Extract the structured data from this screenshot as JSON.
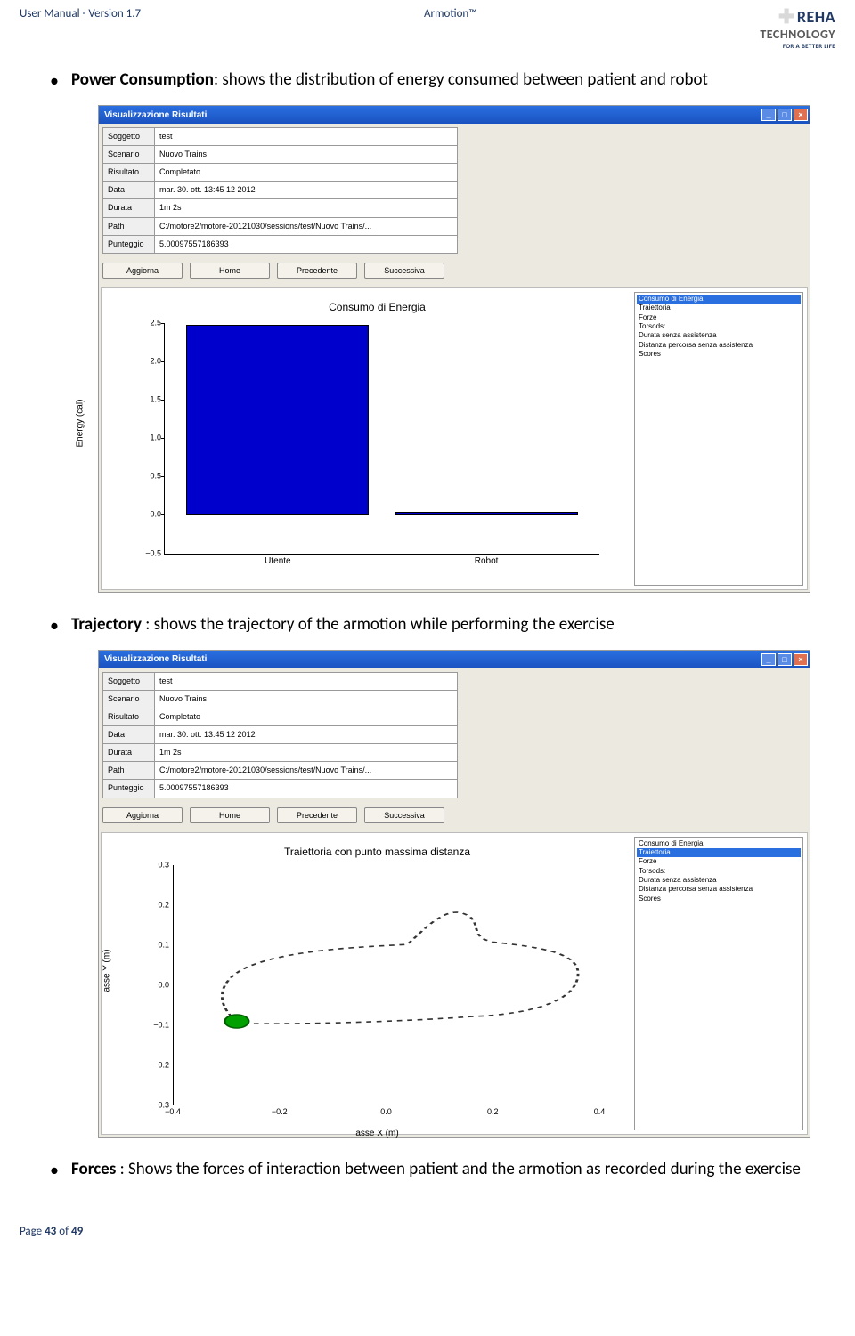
{
  "header": {
    "left": "User Manual - Version 1.7",
    "center": "Armotion™",
    "logo_main": "REHA",
    "logo_sub": "TECHNOLOGY",
    "logo_tag": "FOR A BETTER LIFE"
  },
  "bullets": {
    "power_label": "Power Consumption",
    "power_text": ": shows the distribution of energy consumed between patient and robot",
    "traj_label": "Trajectory",
    "traj_text": " : shows the trajectory of the armotion while performing the exercise",
    "forces_label": "Forces",
    "forces_text": " : Shows the forces of interaction between patient and the armotion as recorded during the exercise"
  },
  "win1": {
    "title": "Visualizzazione Risultati",
    "rows": [
      [
        "Soggetto",
        "test"
      ],
      [
        "Scenario",
        "Nuovo Trains"
      ],
      [
        "Risultato",
        "Completato"
      ],
      [
        "Data",
        "mar. 30. ott. 13:45 12 2012"
      ],
      [
        "Durata",
        "1m 2s"
      ],
      [
        "Path",
        "C:/motore2/motore-20121030/sessions/test/Nuovo Trains/..."
      ],
      [
        "Punteggio",
        "5.00097557186393"
      ]
    ],
    "buttons": [
      "Aggiorna",
      "Home",
      "Precedente",
      "Successiva"
    ],
    "list": [
      "Consumo di Energia",
      "Traiettoria",
      "Forze",
      "Torsods:",
      "Durata senza assistenza",
      "Distanza percorsa senza assistenza",
      "Scores"
    ],
    "selected": 0,
    "chart_title": "Consumo di Energia",
    "ylabel": "Energy (cal)"
  },
  "win2": {
    "title": "Visualizzazione Risultati",
    "rows": [
      [
        "Soggetto",
        "test"
      ],
      [
        "Scenario",
        "Nuovo Trains"
      ],
      [
        "Risultato",
        "Completato"
      ],
      [
        "Data",
        "mar. 30. ott. 13:45 12 2012"
      ],
      [
        "Durata",
        "1m 2s"
      ],
      [
        "Path",
        "C:/motore2/motore-20121030/sessions/test/Nuovo Trains/..."
      ],
      [
        "Punteggio",
        "5.00097557186393"
      ]
    ],
    "buttons": [
      "Aggiorna",
      "Home",
      "Precedente",
      "Successiva"
    ],
    "list": [
      "Consumo di Energia",
      "Traiettoria",
      "Forze",
      "Torsods:",
      "Durata senza assistenza",
      "Distanza percorsa senza assistenza",
      "Scores"
    ],
    "selected": 1,
    "chart_title": "Traiettoria con punto massima distanza",
    "xlabel": "asse X (m)",
    "ylabel": "asse Y (m)"
  },
  "chart_data": [
    {
      "type": "bar",
      "title": "Consumo di Energia",
      "ylabel": "Energy (cal)",
      "ylim": [
        -0.5,
        2.5
      ],
      "categories": [
        "Utente",
        "Robot"
      ],
      "values": [
        2.48,
        0.03
      ]
    },
    {
      "type": "scatter",
      "title": "Traiettoria con punto massima distanza",
      "xlabel": "asse X (m)",
      "ylabel": "asse Y (m)",
      "xlim": [
        -0.4,
        0.4
      ],
      "ylim": [
        -0.3,
        0.3
      ],
      "x_ticks": [
        -0.4,
        -0.2,
        0.0,
        0.2,
        0.4
      ],
      "y_ticks": [
        -0.3,
        -0.2,
        -0.1,
        0.0,
        0.1,
        0.2,
        0.3
      ],
      "marker_point": {
        "x": -0.28,
        "y": -0.09,
        "color": "#00a000"
      },
      "note": "closed-loop handwriting-like trajectory roughly bounded x∈[-0.37,0.36], y∈[-0.13,0.21]"
    }
  ],
  "footer": {
    "prefix": "Page ",
    "num": "43",
    "mid": " of ",
    "total": "49"
  }
}
